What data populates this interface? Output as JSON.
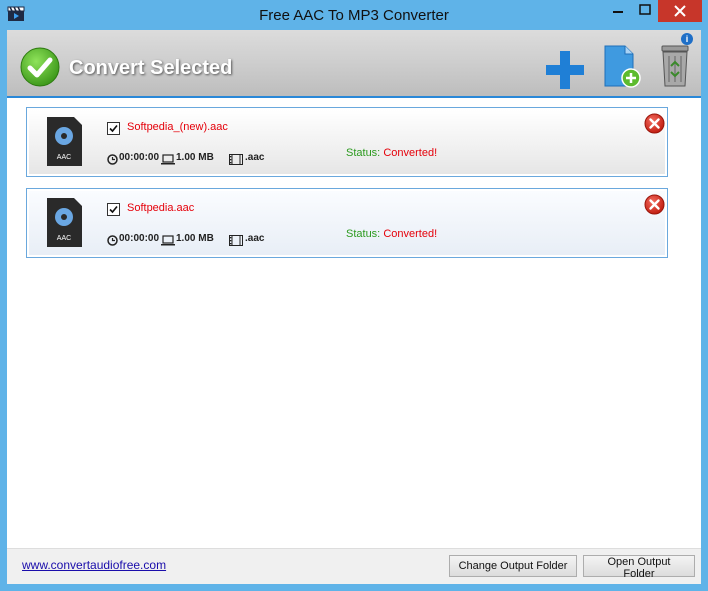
{
  "window": {
    "title": "Free AAC To MP3 Converter"
  },
  "toolbar": {
    "convert_label": "Convert Selected",
    "info_symbol": "i",
    "icons": [
      "checkmark-icon",
      "plus-icon",
      "add-file-icon",
      "recycle-bin-icon",
      "info-icon"
    ]
  },
  "files": [
    {
      "name": "Softpedia_(new).aac",
      "duration": "00:00:00",
      "size": "1.00 MB",
      "format": ".aac",
      "status_label": "Status:",
      "status_value": "Converted!",
      "checked": true
    },
    {
      "name": "Softpedia.aac",
      "duration": "00:00:00",
      "size": "1.00 MB",
      "format": ".aac",
      "status_label": "Status:",
      "status_value": "Converted!",
      "checked": true
    }
  ],
  "file_icon_label": "AAC",
  "footer": {
    "link": "www.convertaudiofree.com",
    "change_output": "Change Output Folder",
    "open_output": "Open Output Folder"
  },
  "colors": {
    "accent": "#2a88d8",
    "titlebar": "#5fb3e8",
    "filename": "#e5000a",
    "status_label": "#2b9a1e",
    "close_button": "#c7362a"
  }
}
